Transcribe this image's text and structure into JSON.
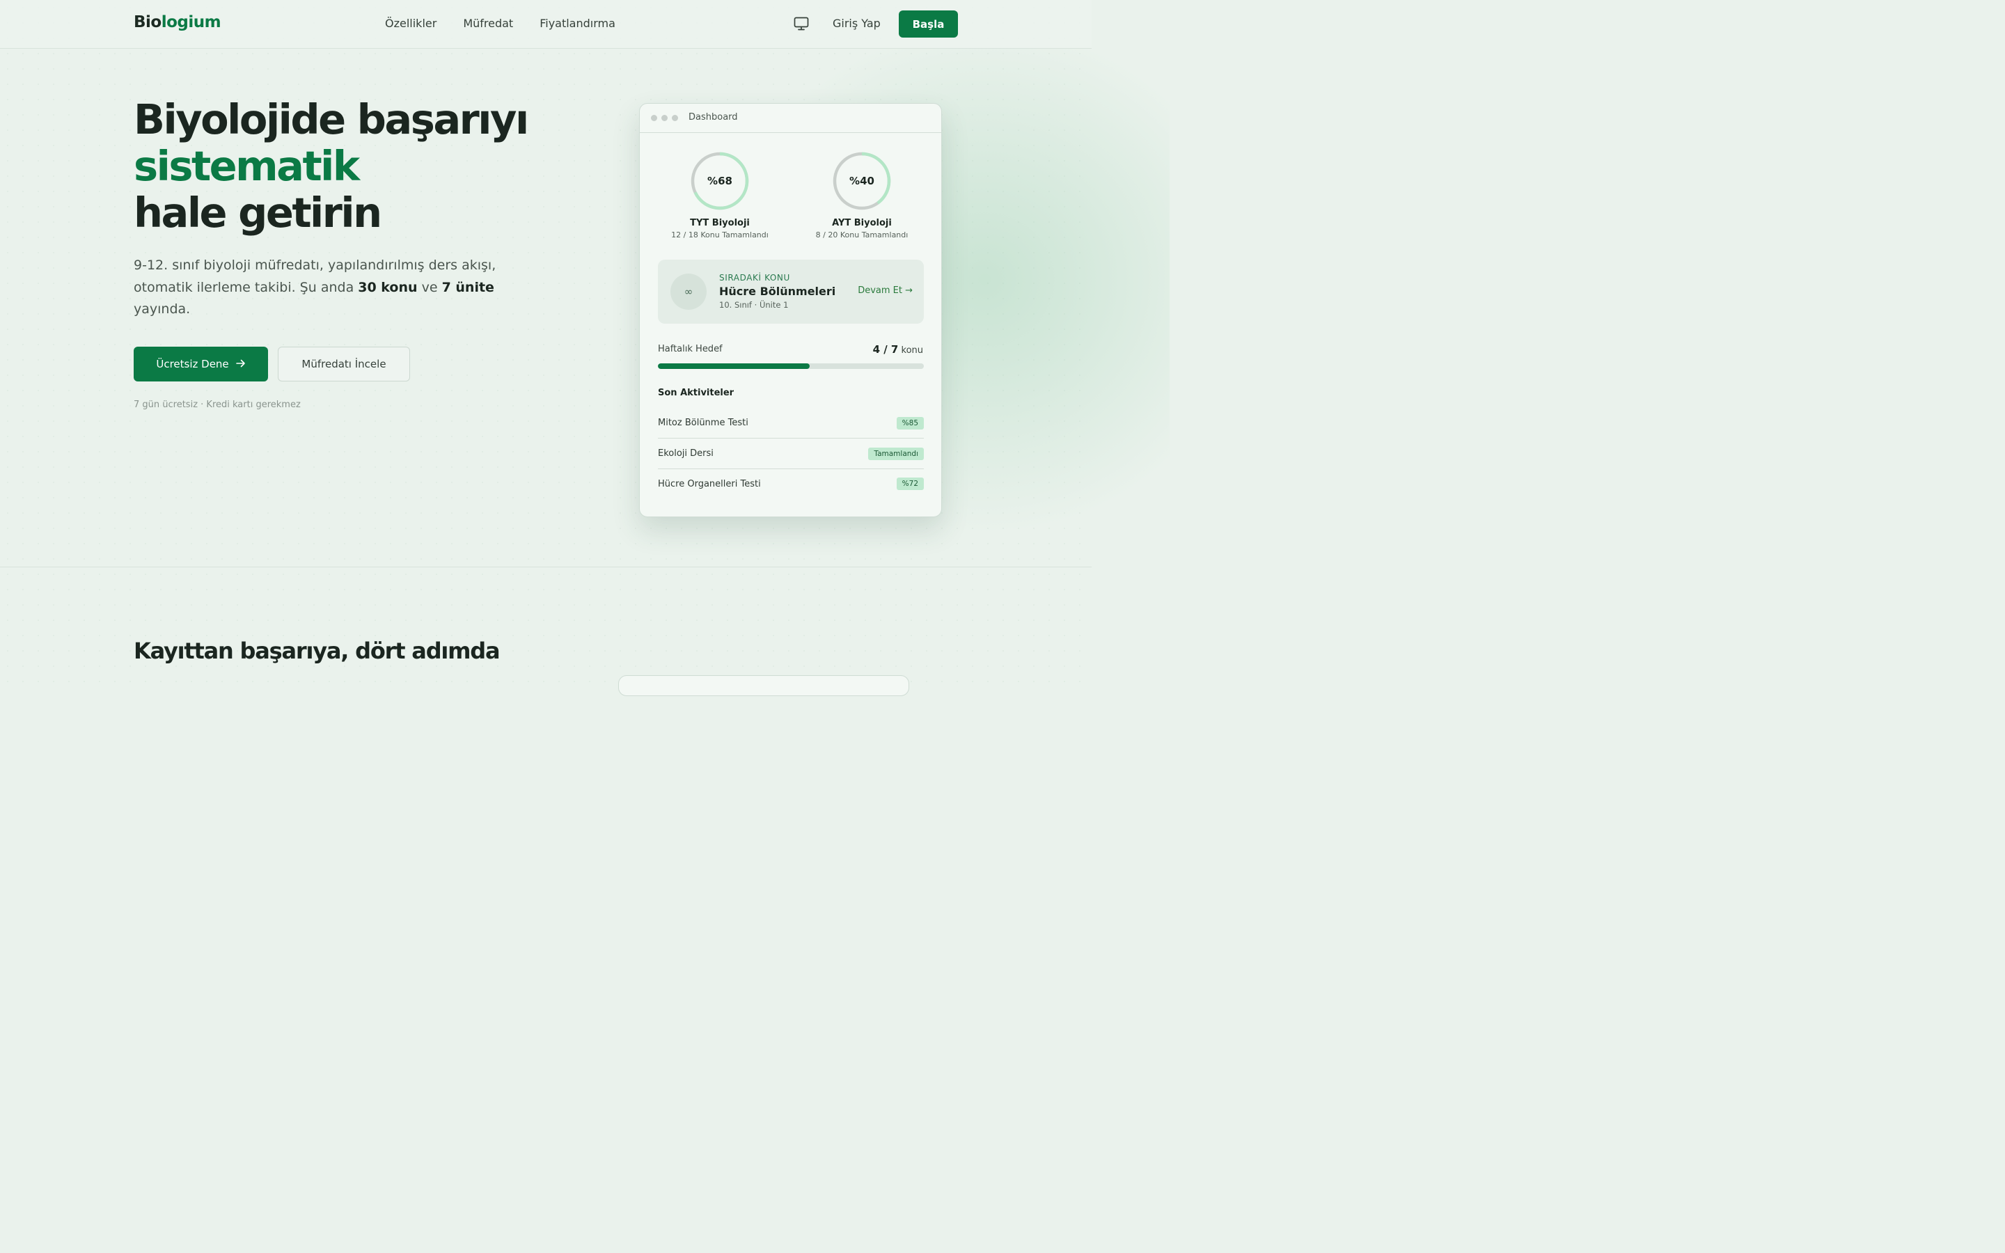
{
  "brand": {
    "name_part1": "Bio",
    "name_part2": "logium",
    "accent_color": "#0b7a45"
  },
  "nav": {
    "items": [
      "Özellikler",
      "Müfredat",
      "Fiyatlandırma"
    ]
  },
  "header": {
    "theme_icon": "monitor-icon",
    "login_label": "Giriş Yap",
    "start_label": "Başla"
  },
  "hero": {
    "title_line1": "Biyolojide başarıyı",
    "title_line2": "sistematik",
    "title_line3": "hale getirin",
    "subtitle_part1": "9-12. sınıf biyoloji müfredatı, yapılandırılmış ders akışı, otomatik ilerleme takibi. Şu anda ",
    "subtitle_bold1": "30 konu",
    "subtitle_part2": " ve ",
    "subtitle_bold2": "7 ünite",
    "subtitle_part3": " yayında.",
    "primary_cta": "Ücretsiz Dene",
    "primary_cta_icon": "arrow-right-icon",
    "secondary_cta": "Müfredatı İncele",
    "note": "7 gün ücretsiz · Kredi kartı gerekmez"
  },
  "dashboard": {
    "window_title": "Dashboard",
    "rings": [
      {
        "value_label": "%68",
        "percent": 68,
        "label": "TYT Biyoloji",
        "sub": "12 / 18 Konu Tamamlandı"
      },
      {
        "value_label": "%40",
        "percent": 40,
        "label": "AYT Biyoloji",
        "sub": "8 / 20 Konu Tamamlandı"
      }
    ],
    "next_topic": {
      "icon": "infinity-icon",
      "icon_glyph": "∞",
      "kicker": "SIRADAKİ KONU",
      "title": "Hücre Bölünmeleri",
      "meta": "10. Sınıf · Ünite 1",
      "link": "Devam Et →"
    },
    "weekly_goal": {
      "label": "Haftalık Hedef",
      "value": "4 / 7",
      "unit": "konu",
      "progress": 0.571
    },
    "activities_title": "Son Aktiviteler",
    "activities": [
      {
        "name": "Mitoz Bölünme Testi",
        "badge": "%85"
      },
      {
        "name": "Ekoloji Dersi",
        "badge": "Tamamlandı"
      },
      {
        "name": "Hücre Organelleri Testi",
        "badge": "%72"
      }
    ]
  },
  "section": {
    "title": "Kayıttan başarıya, dört adımda"
  }
}
